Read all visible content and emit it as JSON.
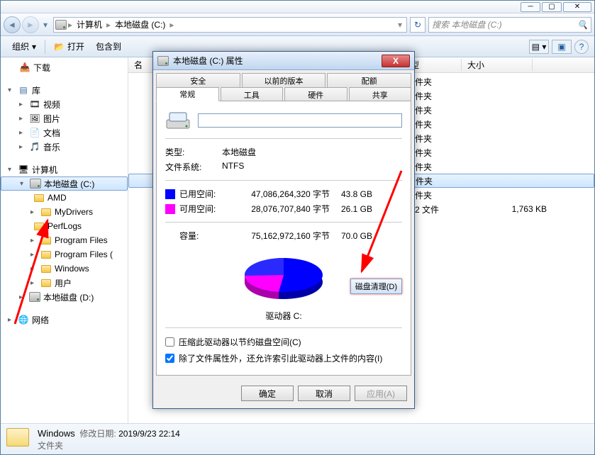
{
  "breadcrumb": {
    "root": "计算机",
    "current": "本地磁盘 (C:)"
  },
  "search": {
    "placeholder": "搜索 本地磁盘 (C:)"
  },
  "toolbar": {
    "organize": "组织",
    "open": "打开",
    "include": "包含到",
    "col_name": "名",
    "col_type": "型",
    "col_size": "大小"
  },
  "sidebar": {
    "downloads": "下载",
    "libraries": "库",
    "videos": "视频",
    "pictures": "图片",
    "documents": "文档",
    "music": "音乐",
    "computer": "计算机",
    "c_drive": "本地磁盘 (C:)",
    "amd": "AMD",
    "mydrivers": "MyDrivers",
    "perflogs": "PerfLogs",
    "progfiles": "Program Files",
    "progfilesx": "Program Files (",
    "windows_f": "Windows",
    "users": "用户",
    "d_drive": "本地磁盘 (D:)",
    "network": "网络"
  },
  "files": {
    "type_folder": "件夹",
    "type_file": "2 文件",
    "size1": "1,763 KB"
  },
  "details": {
    "name": "Windows",
    "mod_label": "修改日期:",
    "mod_date": "2019/9/23 22:14",
    "type": "文件夹"
  },
  "dialog": {
    "title": "本地磁盘 (C:) 属性",
    "tabs_top": [
      "安全",
      "以前的版本",
      "配额"
    ],
    "tabs_bot": [
      "常规",
      "工具",
      "硬件",
      "共享"
    ],
    "type_label": "类型:",
    "type_val": "本地磁盘",
    "fs_label": "文件系统:",
    "fs_val": "NTFS",
    "used_label": "已用空间:",
    "used_bytes": "47,086,264,320 字节",
    "used_gb": "43.8 GB",
    "free_label": "可用空间:",
    "free_bytes": "28,076,707,840 字节",
    "free_gb": "26.1 GB",
    "cap_label": "容量:",
    "cap_bytes": "75,162,972,160 字节",
    "cap_gb": "70.0 GB",
    "pie_caption": "驱动器 C:",
    "cleanup": "磁盘清理(D)",
    "compress": "压缩此驱动器以节约磁盘空间(C)",
    "index": "除了文件属性外，还允许索引此驱动器上文件的内容(I)",
    "ok": "确定",
    "cancel": "取消",
    "apply": "应用(A)"
  },
  "colors": {
    "used": "#0000ff",
    "free": "#ff00ff"
  },
  "chart_data": {
    "type": "pie",
    "title": "驱动器 C:",
    "categories": [
      "已用空间",
      "可用空间"
    ],
    "values": [
      43.8,
      26.1
    ],
    "unit": "GB",
    "colors": [
      "#0000ff",
      "#ff00ff"
    ]
  }
}
